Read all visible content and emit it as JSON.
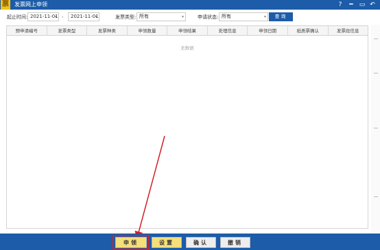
{
  "titlebar": {
    "app_icon_glyph": "票",
    "title": "发票网上申领",
    "controls": [
      {
        "name": "help-icon",
        "glyph": "?"
      },
      {
        "name": "minimize-icon",
        "glyph": "━"
      },
      {
        "name": "restore-icon",
        "glyph": "▭"
      },
      {
        "name": "back-icon",
        "glyph": "↶"
      }
    ]
  },
  "filters": {
    "date_label": "起止时间:",
    "start_date": "2021-11-01",
    "end_date": "2021-11-01",
    "range_separator": "-",
    "invoice_type_label": "发票类型:",
    "invoice_type_value": "所有",
    "apply_status_label": "申请状态:",
    "apply_status_value": "所有",
    "query_button": "查询"
  },
  "table": {
    "columns": [
      "预申请编号",
      "发票类型",
      "发票种类",
      "申领数量",
      "申领结果",
      "处理信息",
      "申领日期",
      "纸质票确认",
      "发票段信息"
    ],
    "empty_text": "无数据"
  },
  "actions": {
    "apply_button": "申领",
    "settings_button": "设置",
    "confirm_button": "确认",
    "cancel_button": "撤销"
  },
  "colors": {
    "titlebar_bg": "#1c5ca8",
    "accent_yellow": "#f4df7a",
    "highlight_red": "#d11f26"
  }
}
